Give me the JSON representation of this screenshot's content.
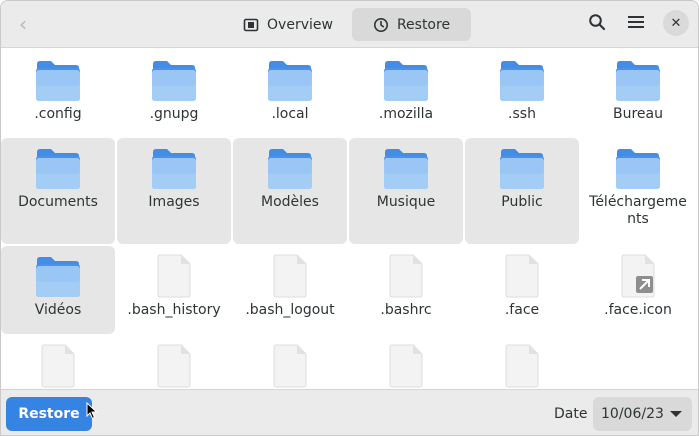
{
  "header": {
    "back_icon": "go-back-icon",
    "tabs": [
      {
        "label": "Overview",
        "icon": "overview-icon",
        "active": false
      },
      {
        "label": "Restore",
        "icon": "clock-icon",
        "active": true
      }
    ],
    "search_icon": "search-icon",
    "menu_icon": "hamburger-menu-icon",
    "close_icon": "close-icon",
    "close_glyph": "✕"
  },
  "files": [
    {
      "name": ".config",
      "type": "folder",
      "selected": false
    },
    {
      "name": ".gnupg",
      "type": "folder",
      "selected": false
    },
    {
      "name": ".local",
      "type": "folder",
      "selected": false
    },
    {
      "name": ".mozilla",
      "type": "folder",
      "selected": false
    },
    {
      "name": ".ssh",
      "type": "folder",
      "selected": false
    },
    {
      "name": "Bureau",
      "type": "folder",
      "selected": false
    },
    {
      "name": "Documents",
      "type": "folder",
      "selected": true
    },
    {
      "name": "Images",
      "type": "folder",
      "selected": true
    },
    {
      "name": "Modèles",
      "type": "folder",
      "selected": true
    },
    {
      "name": "Musique",
      "type": "folder",
      "selected": true
    },
    {
      "name": "Public",
      "type": "folder",
      "selected": true
    },
    {
      "name": "Téléchargem­ents",
      "type": "folder",
      "selected": false
    },
    {
      "name": "Vidéos",
      "type": "folder",
      "selected": true
    },
    {
      "name": ".bash_history",
      "type": "file",
      "selected": false
    },
    {
      "name": ".bash_logout",
      "type": "file",
      "selected": false
    },
    {
      "name": ".bashrc",
      "type": "file",
      "selected": false
    },
    {
      "name": ".face",
      "type": "file",
      "selected": false
    },
    {
      "name": ".face.icon",
      "type": "symlink",
      "selected": false
    },
    {
      "name": "",
      "type": "file",
      "selected": false
    },
    {
      "name": "",
      "type": "file",
      "selected": false
    },
    {
      "name": "",
      "type": "file",
      "selected": false
    },
    {
      "name": "",
      "type": "file",
      "selected": false
    },
    {
      "name": "",
      "type": "file",
      "selected": false
    }
  ],
  "footer": {
    "restore_label": "Restore",
    "date_label": "Date",
    "date_value": "10/06/23"
  },
  "colors": {
    "accent": "#3584e4",
    "folder_light": "#a4cdf5",
    "folder_dark": "#438de6",
    "selection": "#e6e6e6"
  }
}
